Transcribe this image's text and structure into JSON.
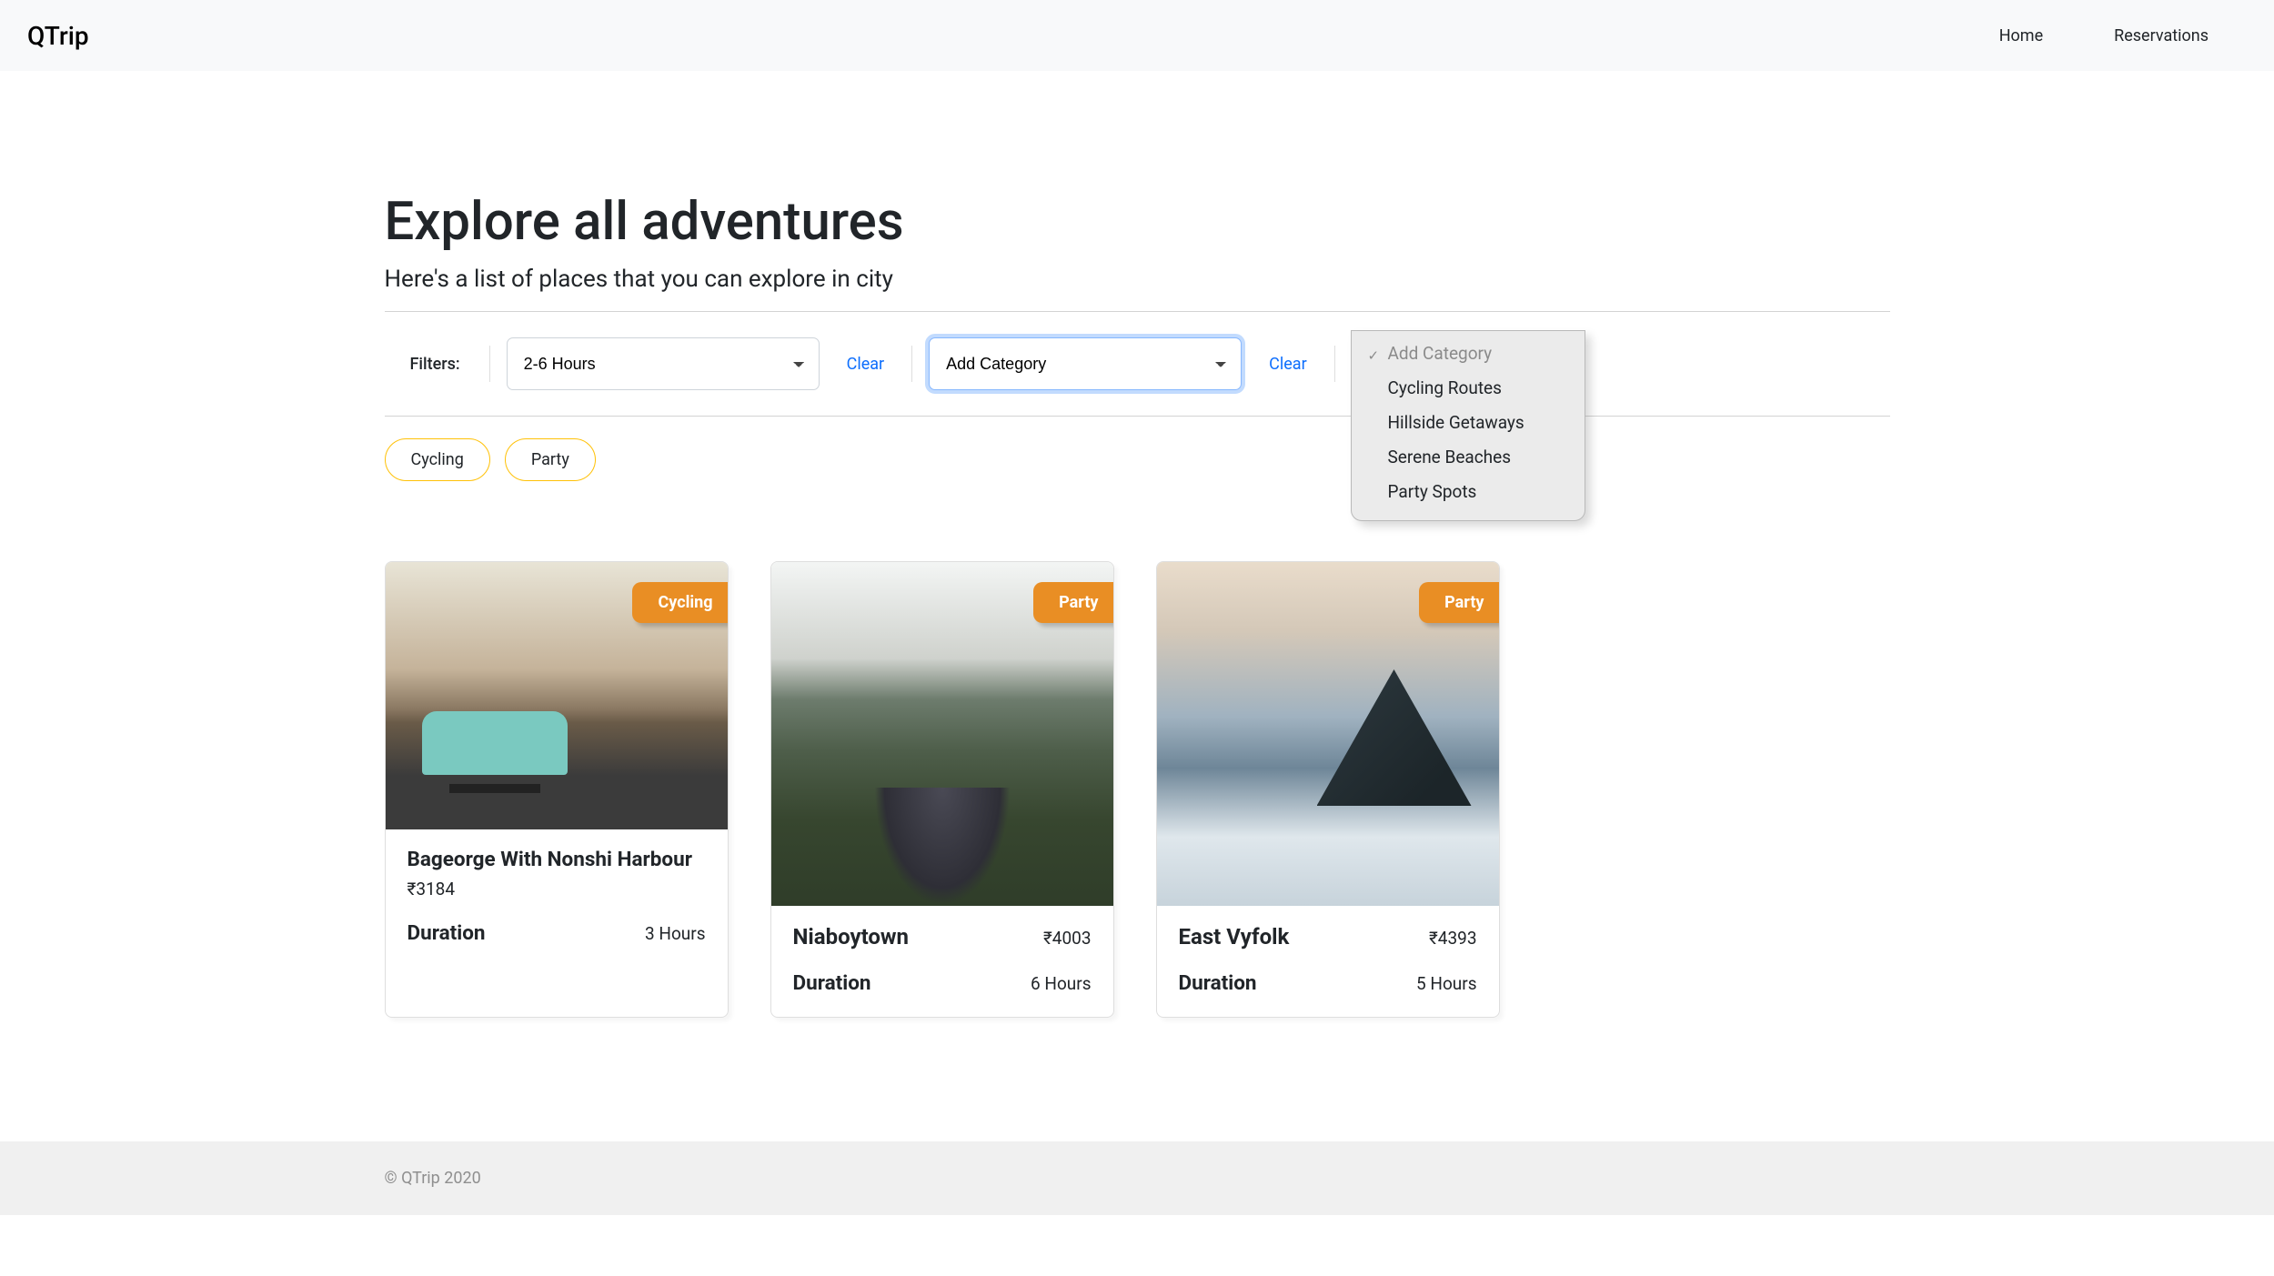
{
  "nav": {
    "brand": "QTrip",
    "links": [
      {
        "label": "Home"
      },
      {
        "label": "Reservations"
      }
    ]
  },
  "page": {
    "title": "Explore all adventures",
    "subtitle": "Here's a list of places that you can explore in city"
  },
  "filters": {
    "label": "Filters:",
    "duration": {
      "selected": "2-6 Hours"
    },
    "clear1": "Clear",
    "category": {
      "placeholder": "Add Category",
      "options": [
        "Cycling Routes",
        "Hillside Getaways",
        "Serene Beaches",
        "Party Spots"
      ]
    },
    "clear2": "Clear"
  },
  "applied_pills": [
    "Cycling",
    "Party"
  ],
  "cards": [
    {
      "badge": "Cycling",
      "title": "Bageorge With Nonshi Harbour",
      "price": "₹3184",
      "duration_label": "Duration",
      "duration_value": "3 Hours"
    },
    {
      "badge": "Party",
      "title": "Niaboytown",
      "price": "₹4003",
      "duration_label": "Duration",
      "duration_value": "6 Hours"
    },
    {
      "badge": "Party",
      "title": "East Vyfolk",
      "price": "₹4393",
      "duration_label": "Duration",
      "duration_value": "5 Hours"
    }
  ],
  "footer": {
    "copyright": "© QTrip 2020"
  }
}
